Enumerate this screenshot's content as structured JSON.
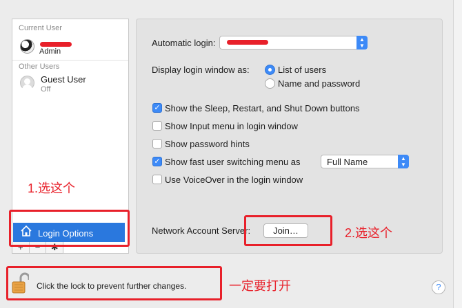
{
  "users": {
    "current_header": "Current User",
    "current_role": "Admin",
    "other_header": "Other Users",
    "guest_name": "Guest User",
    "guest_status": "Off",
    "login_options_label": "Login Options",
    "add_symbol": "+",
    "remove_symbol": "−",
    "actions_symbol": "✱"
  },
  "options": {
    "automatic_login_label": "Automatic login:",
    "display_login_label": "Display login window as:",
    "radio_list": "List of users",
    "radio_name_password": "Name and password",
    "selected_display_mode": "List of users",
    "checkboxes": [
      {
        "label": "Show the Sleep, Restart, and Shut Down buttons",
        "checked": true
      },
      {
        "label": "Show Input menu in login window",
        "checked": false
      },
      {
        "label": "Show password hints",
        "checked": false
      },
      {
        "label": "Show fast user switching menu as",
        "checked": true
      },
      {
        "label": "Use VoiceOver in the login window",
        "checked": false
      }
    ],
    "fast_switching_value": "Full Name",
    "network_server_label": "Network Account Server:",
    "join_button": "Join…"
  },
  "footer": {
    "lock_text": "Click the lock to prevent further changes.",
    "help_symbol": "?"
  },
  "annotations": {
    "step1": "1.选这个",
    "step2": "2.选这个",
    "unlock": "一定要打开"
  },
  "colors": {
    "accent": "#3d8af7",
    "selection": "#2a78de",
    "annotation_red": "#e8202a"
  }
}
